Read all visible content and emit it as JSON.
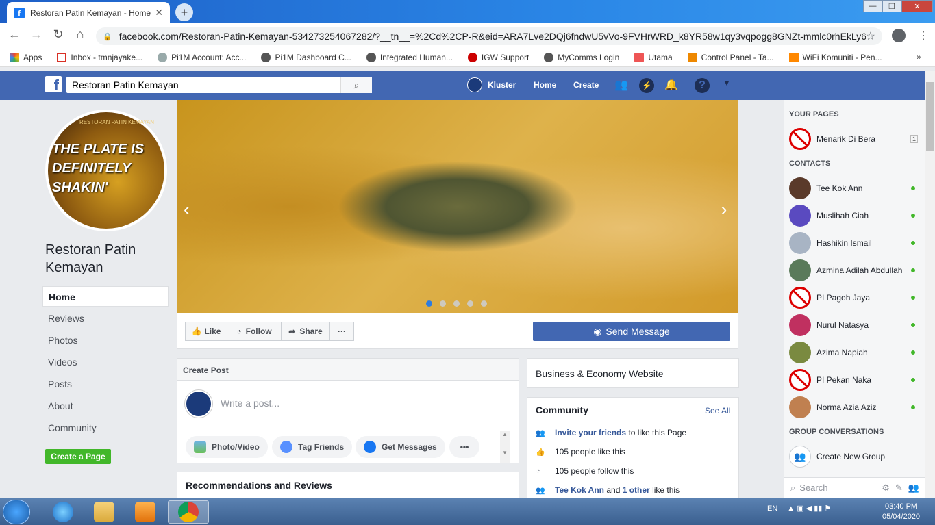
{
  "browser": {
    "tab_title": "Restoran Patin Kemayan - Home",
    "url": "facebook.com/Restoran-Patin-Kemayan-534273254067282/?__tn__=%2Cd%2CP-R&eid=ARA7Lve2DQj6fndwU5vVo-9FVHrWRD_k8YR58w1qy3vqpogg8GNZt-mmlc0rhEkLy6...",
    "bookmarks": [
      "Apps",
      "Inbox - tmnjayake...",
      "Pi1M Account: Acc...",
      "Pi1M Dashboard C...",
      "Integrated Human...",
      "IGW Support",
      "MyComms Login",
      "Utama",
      "Control Panel - Ta...",
      "WiFi Komuniti - Pen..."
    ]
  },
  "fb_header": {
    "search_value": "Restoran Patin Kemayan",
    "profile_name": "Kluster",
    "home": "Home",
    "create": "Create"
  },
  "page": {
    "avatar_text": "THE PLATE IS DEFINITELY SHAKIN'",
    "avatar_top": "RESTORAN PATIN KEMAYAN",
    "name": "Restoran Patin Kemayan",
    "nav": [
      "Home",
      "Reviews",
      "Photos",
      "Videos",
      "Posts",
      "About",
      "Community"
    ],
    "create_page": "Create a Page"
  },
  "actions": {
    "like": "Like",
    "follow": "Follow",
    "share": "Share",
    "more": "···",
    "send_message": "Send Message"
  },
  "create_post": {
    "title": "Create Post",
    "placeholder": "Write a post...",
    "buttons": [
      "Photo/Video",
      "Tag Friends",
      "Get Messages"
    ],
    "more": "•••"
  },
  "recommendations": "Recommendations and Reviews",
  "business": "Business & Economy Website",
  "community": {
    "title": "Community",
    "see_all": "See All",
    "invite_link": "Invite your friends",
    "invite_rest": " to like this Page",
    "likes": "105 people like this",
    "follows": "105 people follow this",
    "friend_name": "Tee Kok Ann",
    "friend_and": " and ",
    "friend_other": "1 other",
    "friend_rest": " like this"
  },
  "sidebar": {
    "your_pages": "YOUR PAGES",
    "page_item": "Menarik Di Bera",
    "page_badge": "1",
    "contacts_head": "CONTACTS",
    "contacts": [
      "Tee Kok Ann",
      "Muslihah Ciah",
      "Hashikin Ismail",
      "Azmina Adilah Abdullah",
      "PI Pagoh Jaya",
      "Nurul Natasya",
      "Azima Napiah",
      "PI Pekan Naka",
      "Norma Azia Aziz"
    ],
    "group_head": "GROUP CONVERSATIONS",
    "create_group": "Create New Group",
    "search": "Search"
  },
  "taskbar": {
    "lang": "EN",
    "time": "03:40 PM",
    "date": "05/04/2020"
  },
  "colors": {
    "fb_blue": "#4267b2",
    "green": "#42b72a",
    "link": "#365899"
  }
}
